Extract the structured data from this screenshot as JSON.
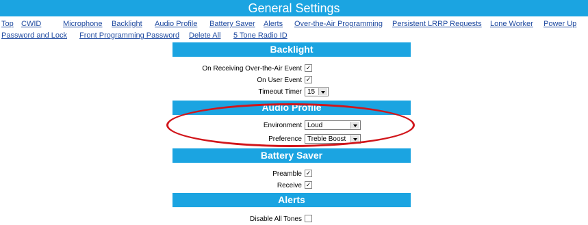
{
  "page": {
    "title": "General Settings"
  },
  "nav": {
    "links": [
      "Top",
      "CWID",
      "Microphone",
      "Backlight",
      "Audio Profile",
      "Battery Saver",
      "Alerts",
      "Over-the-Air Programming",
      "Persistent LRRP Requests",
      "Lone Worker",
      "Power Up",
      "Password and Lock",
      "Front Programming Password",
      "Delete All",
      "5 Tone Radio ID"
    ]
  },
  "sections": {
    "backlight": {
      "title": "Backlight",
      "on_ota_event": {
        "label": "On Receiving Over-the-Air Event",
        "checked": true,
        "mark": "✓"
      },
      "on_user_event": {
        "label": "On User Event",
        "checked": true,
        "mark": "✓"
      },
      "timeout_timer": {
        "label": "Timeout Timer",
        "value": "15"
      }
    },
    "audio_profile": {
      "title": "Audio Profile",
      "environment": {
        "label": "Environment",
        "value": "Loud"
      },
      "preference": {
        "label": "Preference",
        "value": "Treble Boost"
      }
    },
    "battery_saver": {
      "title": "Battery Saver",
      "preamble": {
        "label": "Preamble",
        "checked": true,
        "mark": "✓"
      },
      "receive": {
        "label": "Receive",
        "checked": true,
        "mark": "✓"
      }
    },
    "alerts": {
      "title": "Alerts",
      "disable_all_tones": {
        "label": "Disable All Tones",
        "checked": false,
        "mark": ""
      }
    }
  },
  "colors": {
    "header_bg": "#1ba4e1",
    "link": "#1f4aa0",
    "highlight_ellipse": "#d1161b"
  }
}
